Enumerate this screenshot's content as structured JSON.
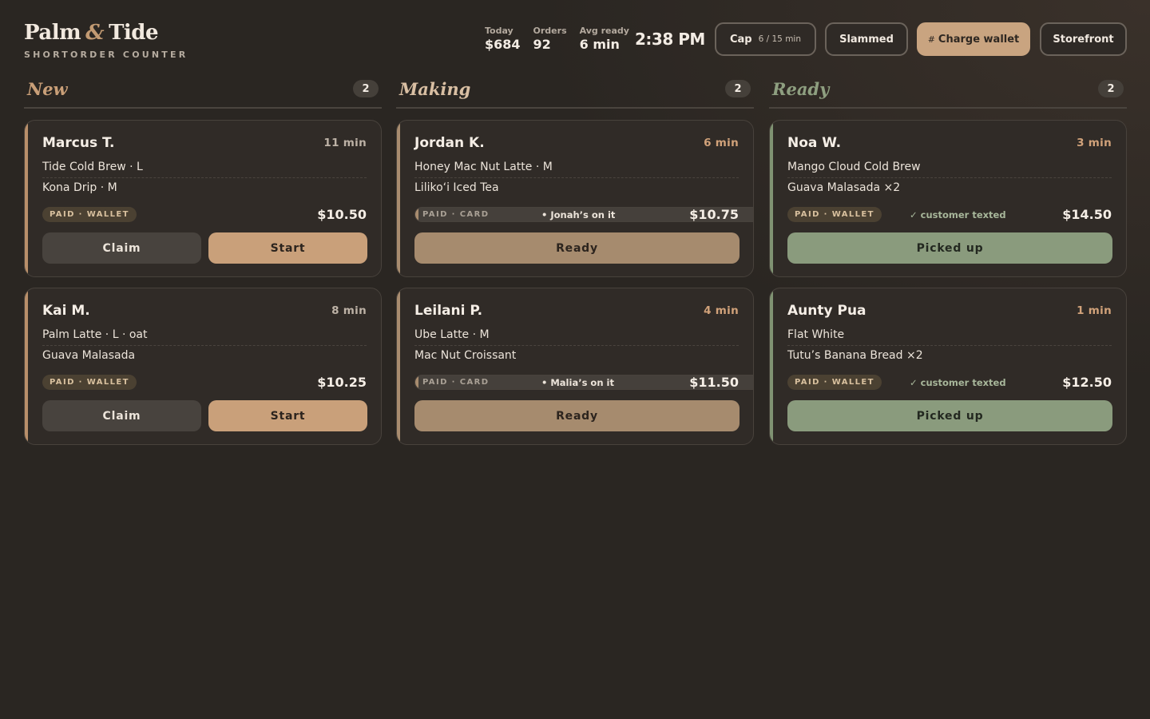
{
  "brand": {
    "name_part1": "Palm",
    "amp": "&",
    "name_part2": "Tide",
    "subtitle": "SHORTORDER COUNTER"
  },
  "stats": [
    {
      "label": "Today",
      "value": "$684"
    },
    {
      "label": "Orders",
      "value": "92"
    },
    {
      "label": "Avg ready",
      "value": "6 min"
    }
  ],
  "clock": "2:38 PM",
  "header_buttons": {
    "cap_label": "Cap",
    "cap_value": "6 / 15 min",
    "slammed_label": "Slammed",
    "wallet_icon": "#",
    "wallet_label": "Charge wallet",
    "storefront_label": "Storefront"
  },
  "colors": {
    "accent": "#c9a07a",
    "ready_green": "#8a9b7d",
    "background": "#2a2622"
  },
  "columns": {
    "new": {
      "title": "New",
      "count": "2",
      "orders": [
        {
          "name": "Marcus T.",
          "time": "11 min",
          "items": [
            "Tide Cold Brew · L",
            "Kona Drip · M"
          ],
          "badge": "PAID · WALLET",
          "price": "$10.50",
          "claim": "Claim",
          "start": "Start"
        },
        {
          "name": "Kai M.",
          "time": "8 min",
          "items": [
            "Palm Latte · L · oat",
            "Guava Malasada"
          ],
          "badge": "PAID · WALLET",
          "price": "$10.25",
          "claim": "Claim",
          "start": "Start"
        }
      ]
    },
    "making": {
      "title": "Making",
      "count": "2",
      "orders": [
        {
          "name": "Jordan K.",
          "time": "6 min",
          "items": [
            "Honey Mac Nut Latte · M",
            "Liliko‘i Iced Tea"
          ],
          "badge": "PAID · CARD",
          "note": "• Jonah’s on it",
          "price": "$10.75",
          "action": "Ready"
        },
        {
          "name": "Leilani P.",
          "time": "4 min",
          "items": [
            "Ube Latte · M",
            "Mac Nut Croissant"
          ],
          "badge": "PAID · CARD",
          "note": "• Malia’s on it",
          "price": "$11.50",
          "action": "Ready"
        }
      ]
    },
    "ready": {
      "title": "Ready",
      "count": "2",
      "orders": [
        {
          "name": "Noa W.",
          "time": "3 min",
          "items": [
            "Mango Cloud Cold Brew",
            "Guava Malasada ×2"
          ],
          "badge": "PAID · WALLET",
          "note": "✓ customer texted",
          "price": "$14.50",
          "action": "Picked up"
        },
        {
          "name": "Aunty Pua",
          "time": "1 min",
          "items": [
            "Flat White",
            "Tutu’s Banana Bread ×2"
          ],
          "badge": "PAID · WALLET",
          "note": "✓ customer texted",
          "price": "$12.50",
          "action": "Picked up"
        }
      ]
    }
  }
}
